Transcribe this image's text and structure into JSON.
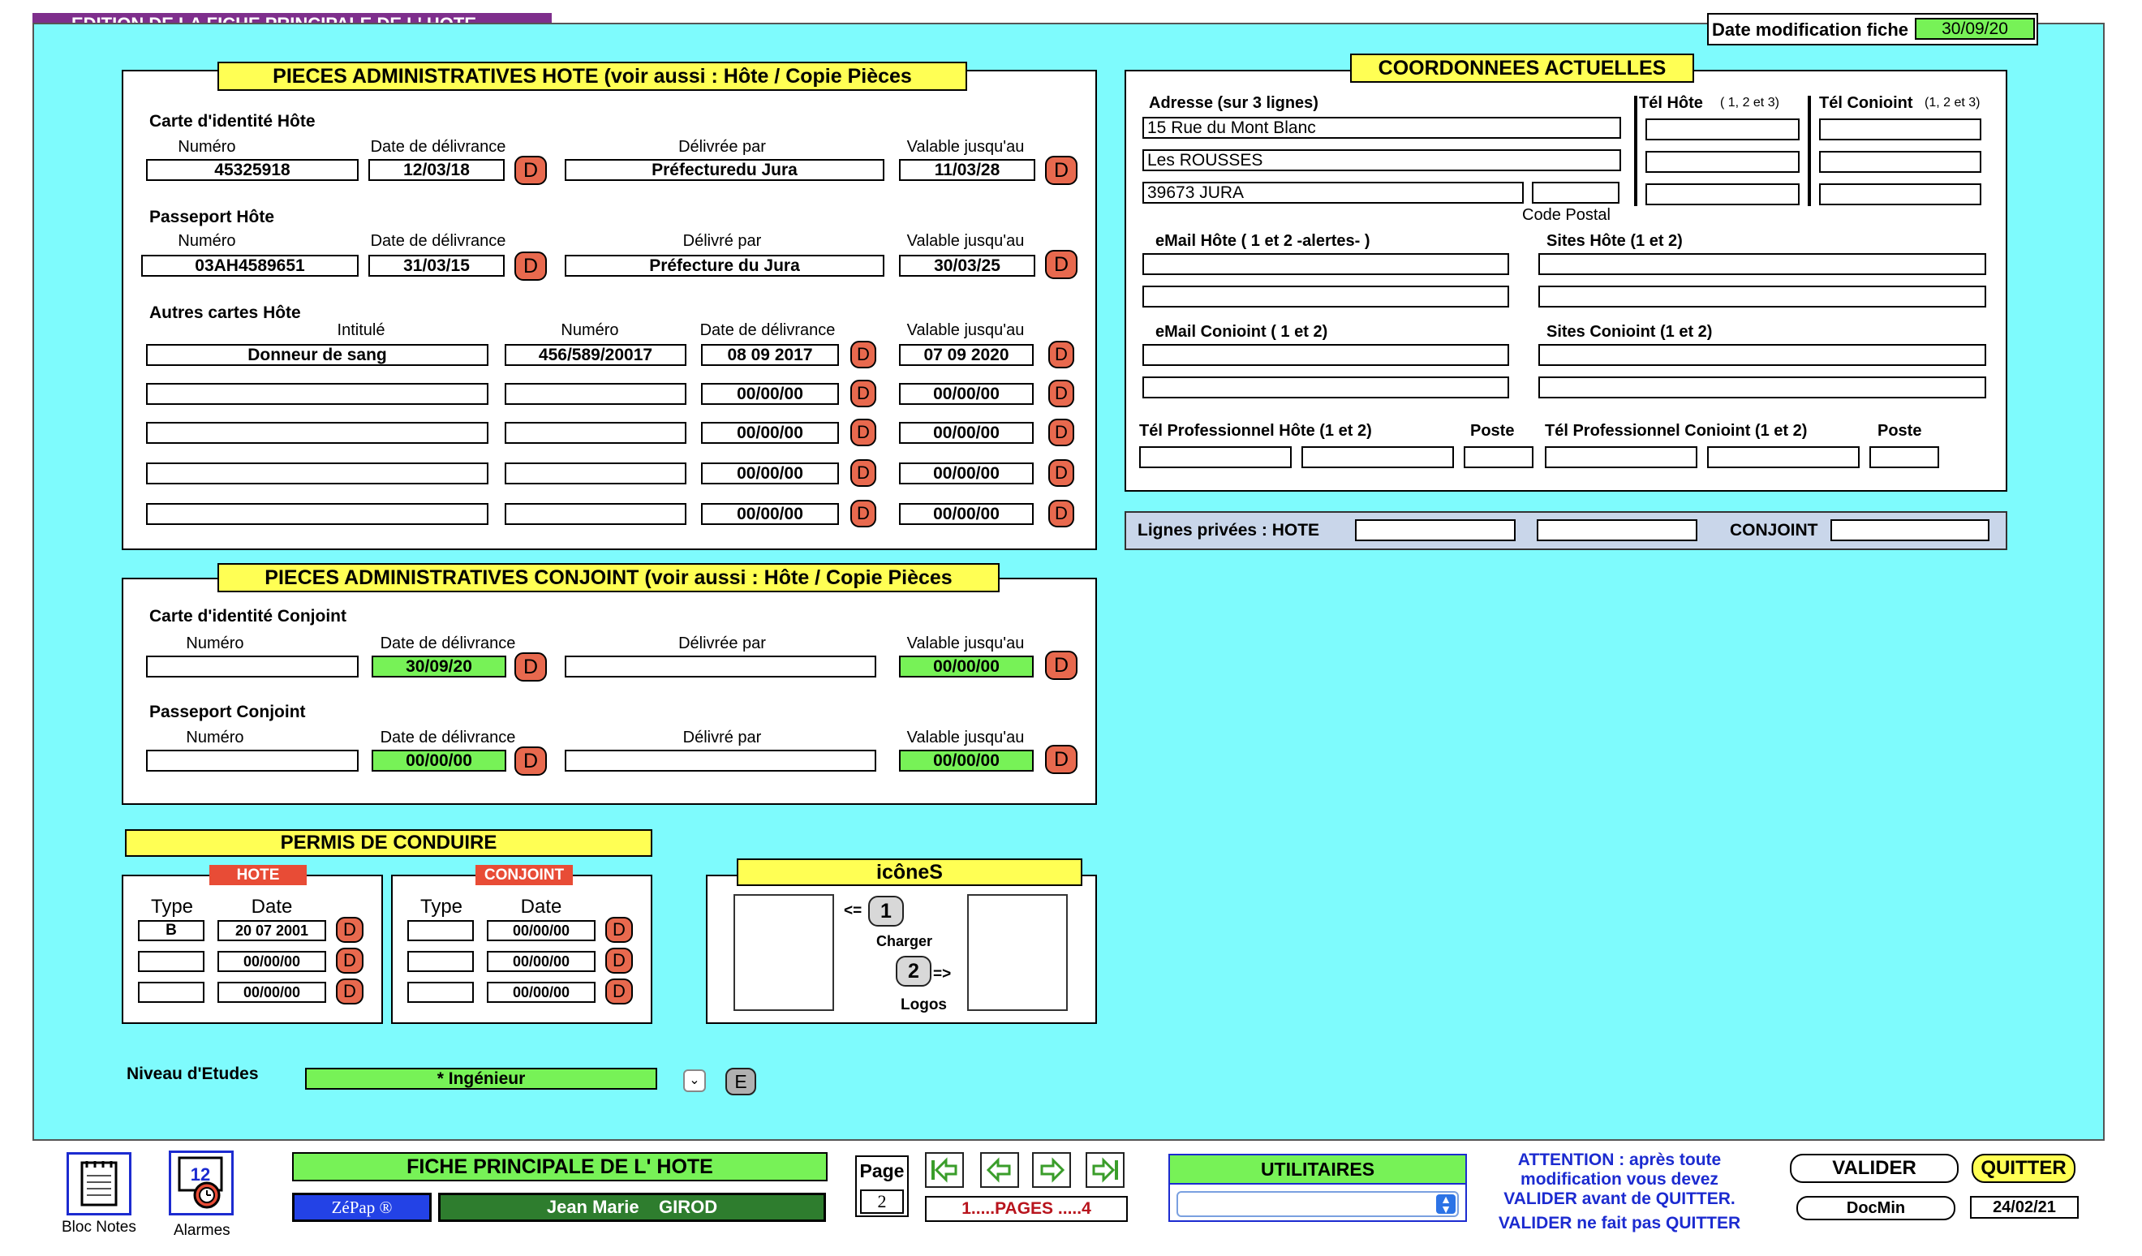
{
  "window": {
    "title": "EDITION DE LA FICHE PRINCIPALE DE L' HOTE",
    "date_mod_label": "Date modification fiche",
    "date_mod_value": "30/09/20"
  },
  "d_label": "D",
  "pieces_hote": {
    "title": "PIECES ADMINISTRATIVES HOTE  (voir aussi : Hôte / Copie Pièces",
    "carte": {
      "heading": "Carte d'identité Hôte",
      "col_numero": "Numéro",
      "col_date": "Date de délivrance",
      "col_par": "Délivrée par",
      "col_valable": "Valable jusqu'au",
      "numero": "45325918",
      "date": "12/03/18",
      "par": "Préfecturedu Jura",
      "valable": "11/03/28"
    },
    "passeport": {
      "heading": "Passeport Hôte",
      "col_numero": "Numéro",
      "col_date": "Date de délivrance",
      "col_par": "Délivré par",
      "col_valable": "Valable jusqu'au",
      "numero": "03AH4589651",
      "date": "31/03/15",
      "par": "Préfecture du Jura",
      "valable": "30/03/25"
    },
    "autres": {
      "heading": "Autres cartes Hôte",
      "col_intitule": "Intitulé",
      "col_numero": "Numéro",
      "col_date": "Date de délivrance",
      "col_valable": "Valable jusqu'au",
      "rows": [
        {
          "intitule": "Donneur de sang",
          "numero": "456/589/20017",
          "date": "08 09 2017",
          "valable": "07 09 2020"
        },
        {
          "intitule": "",
          "numero": "",
          "date": "00/00/00",
          "valable": "00/00/00"
        },
        {
          "intitule": "",
          "numero": "",
          "date": "00/00/00",
          "valable": "00/00/00"
        },
        {
          "intitule": "",
          "numero": "",
          "date": "00/00/00",
          "valable": "00/00/00"
        },
        {
          "intitule": "",
          "numero": "",
          "date": "00/00/00",
          "valable": "00/00/00"
        }
      ]
    }
  },
  "pieces_conjoint": {
    "title": "PIECES ADMINISTRATIVES CONJOINT  (voir aussi :  Hôte / Copie Pièces",
    "carte": {
      "heading": "Carte d'identité Conjoint",
      "col_numero": "Numéro",
      "col_date": "Date de délivrance",
      "col_par": "Délivrée par",
      "col_valable": "Valable jusqu'au",
      "numero": "",
      "date": "30/09/20",
      "par": "",
      "valable": "00/00/00"
    },
    "passeport": {
      "heading": "Passeport Conjoint",
      "col_numero": "Numéro",
      "col_date": "Date de délivrance",
      "col_par": "Délivré par",
      "col_valable": "Valable jusqu'au",
      "numero": "",
      "date": "00/00/00",
      "par": "",
      "valable": "00/00/00"
    }
  },
  "permis": {
    "title": "PERMIS DE CONDUIRE",
    "hote": {
      "tag": "HOTE",
      "col_type": "Type",
      "col_date": "Date",
      "rows": [
        {
          "type": "B",
          "date": "20 07 2001"
        },
        {
          "type": "",
          "date": "00/00/00"
        },
        {
          "type": "",
          "date": "00/00/00"
        }
      ]
    },
    "conjoint": {
      "tag": "CONJOINT",
      "col_type": "Type",
      "col_date": "Date",
      "rows": [
        {
          "type": "",
          "date": "00/00/00"
        },
        {
          "type": "",
          "date": "00/00/00"
        },
        {
          "type": "",
          "date": "00/00/00"
        }
      ]
    }
  },
  "icones": {
    "title": "icôneS",
    "arrow_left": "<=",
    "btn1": "1",
    "charger": "Charger",
    "btn2": "2",
    "arrow_right": "=>",
    "logos": "Logos"
  },
  "niveau": {
    "label": "Niveau d'Etudes",
    "value": "* Ingénieur",
    "e_label": "E"
  },
  "coords": {
    "title": "COORDONNEES ACTUELLES",
    "adresse_label": "Adresse  (sur 3 lignes)",
    "adresse": [
      "15 Rue du Mont Blanc",
      "Les ROUSSES",
      "39673  JURA"
    ],
    "code_postal_label": "Code Postal",
    "code_postal": "",
    "tel_hote_label": "Tél Hôte",
    "tel_hote_note": "( 1, 2 et 3)",
    "tel_conj_label": "Tél Conioint",
    "tel_conj_note": "(1, 2 et 3)",
    "email_hote_label": "eMail Hôte  ( 1  et  2 -alertes- )",
    "sites_hote_label": "Sites Hôte  (1  et  2)",
    "email_conj_label": "eMail Conioint   ( 1  et  2)",
    "sites_conj_label": "Sites Conioint  (1  et  2)",
    "telpro_hote_label": "Tél Professionnel Hôte  (1  et  2)",
    "poste1": "Poste",
    "telpro_conj_label": "Tél Professionnel Conioint  (1  et  2)",
    "poste2": "Poste"
  },
  "lignes": {
    "label": "Lignes  privées :  HOTE",
    "conjoint": "CONJOINT"
  },
  "footer": {
    "bloc_notes": "Bloc Notes",
    "alarmes": "Alarmes",
    "alarm_day": "12",
    "fiche_label": "FICHE  PRINCIPALE  DE  L' HOTE",
    "zepap": "ZéPap ®",
    "user": "Jean Marie    GIROD",
    "page_label": "Page",
    "page_num": "2",
    "pages_text": "1.....PAGES .....4",
    "utilitaires": "UTILITAIRES",
    "attention": [
      "ATTENTION :  après toute",
      "modification vous devez",
      "VALIDER  avant de  QUITTER.",
      "VALIDER ne fait pas QUITTER"
    ],
    "valider": "VALIDER",
    "quitter": "QUITTER",
    "docmin": "DocMin",
    "date": "24/02/21"
  },
  "colors": {
    "cyan": "#7efbfd",
    "yellow": "#ffff54",
    "green": "#77f257",
    "red": "#e8694e",
    "purple": "#7e2e8c"
  }
}
